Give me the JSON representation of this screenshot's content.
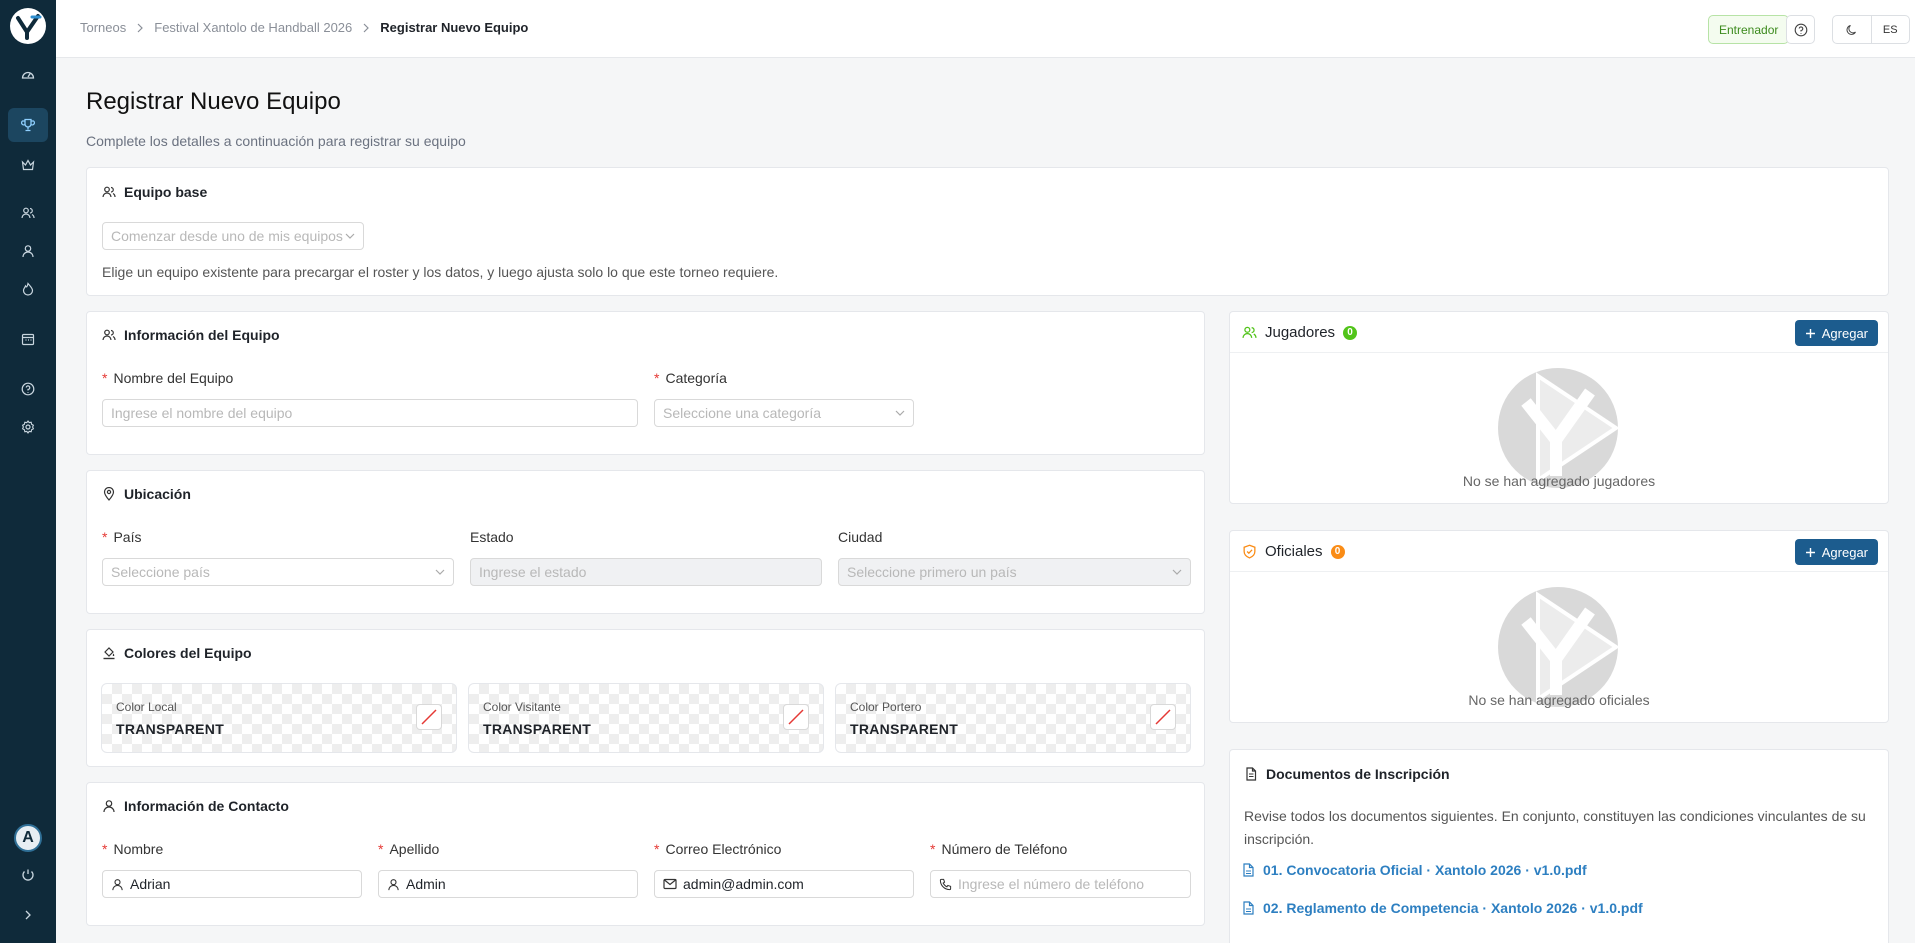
{
  "header": {
    "breadcrumbs": [
      "Torneos",
      "Festival Xantolo de Handball 2026",
      "Registrar Nuevo Equipo"
    ],
    "role": "Entrenador",
    "language": "ES"
  },
  "page": {
    "title": "Registrar Nuevo Equipo",
    "subtitle": "Complete los detalles a continuación para registrar su equipo"
  },
  "base_team": {
    "title": "Equipo base",
    "select_placeholder": "Comenzar desde uno de mis equipos",
    "hint": "Elige un equipo existente para precargar el roster y los datos, y luego ajusta solo lo que este torneo requiere."
  },
  "team_info": {
    "title": "Información del Equipo",
    "name_label": "Nombre del Equipo",
    "name_placeholder": "Ingrese el nombre del equipo",
    "category_label": "Categoría",
    "category_placeholder": "Seleccione una categoría"
  },
  "location": {
    "title": "Ubicación",
    "country_label": "País",
    "country_placeholder": "Seleccione país",
    "state_label": "Estado",
    "state_placeholder": "Ingrese el estado",
    "city_label": "Ciudad",
    "city_placeholder": "Seleccione primero un país"
  },
  "colors": {
    "title": "Colores del Equipo",
    "items": [
      {
        "label": "Color Local",
        "value": "TRANSPARENT"
      },
      {
        "label": "Color Visitante",
        "value": "TRANSPARENT"
      },
      {
        "label": "Color Portero",
        "value": "TRANSPARENT"
      }
    ]
  },
  "contact": {
    "title": "Información de Contacto",
    "first_name_label": "Nombre",
    "first_name_value": "Adrian",
    "last_name_label": "Apellido",
    "last_name_value": "Admin",
    "email_label": "Correo Electrónico",
    "email_value": "admin@admin.com",
    "phone_label": "Número de Teléfono",
    "phone_placeholder": "Ingrese el número de teléfono"
  },
  "players": {
    "title": "Jugadores",
    "count": "0",
    "add_label": "Agregar",
    "empty": "No se han agregado jugadores"
  },
  "officials": {
    "title": "Oficiales",
    "count": "0",
    "add_label": "Agregar",
    "empty": "No se han agregado oficiales"
  },
  "documents": {
    "title": "Documentos de Inscripción",
    "description": "Revise todos los documentos siguientes. En conjunto, constituyen las condiciones vinculantes de su inscripción.",
    "items": [
      "01. Convocatoria Oficial · Xantolo 2026 · v1.0.pdf",
      "02. Reglamento de Competencia · Xantolo 2026 · v1.0.pdf"
    ]
  },
  "colors_theme": {
    "sidebar_bg": "#0f2a3a",
    "primary": "#1c5c8e",
    "link": "#2d7fc1",
    "required": "#e53935",
    "success": "#52c41a",
    "warning": "#fa8c16"
  }
}
